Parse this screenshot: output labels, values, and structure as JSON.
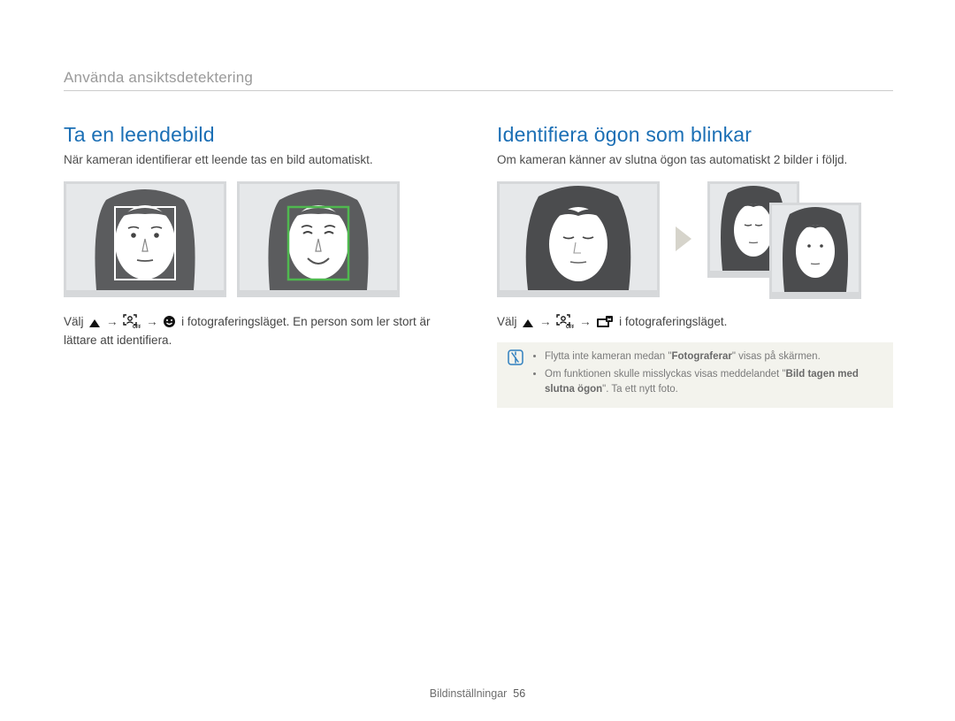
{
  "breadcrumb": "Använda ansiktsdetektering",
  "left": {
    "title": "Ta en leendebild",
    "intro": "När kameran identifierar ett leende tas en bild automatiskt.",
    "select_prefix": "Välj ",
    "select_mid": " i fotograferingsläget. En person som ler stort är lättare att identifiera."
  },
  "right": {
    "title": "Identifiera ögon som blinkar",
    "intro": "Om kameran känner av slutna ögon tas automatiskt 2 bilder i följd.",
    "select_prefix": "Välj ",
    "select_mid": " i fotograferingsläget.",
    "note1a": "Flytta inte kameran medan \"",
    "note1b": "Fotograferar",
    "note1c": "\" visas på skärmen.",
    "note2a": "Om funktionen skulle misslyckas visas meddelandet \"",
    "note2b": "Bild tagen med slutna ögon",
    "note2c": "\". Ta ett nytt foto."
  },
  "arrow": "→",
  "footer": {
    "section": "Bildinställningar",
    "page": "56"
  }
}
